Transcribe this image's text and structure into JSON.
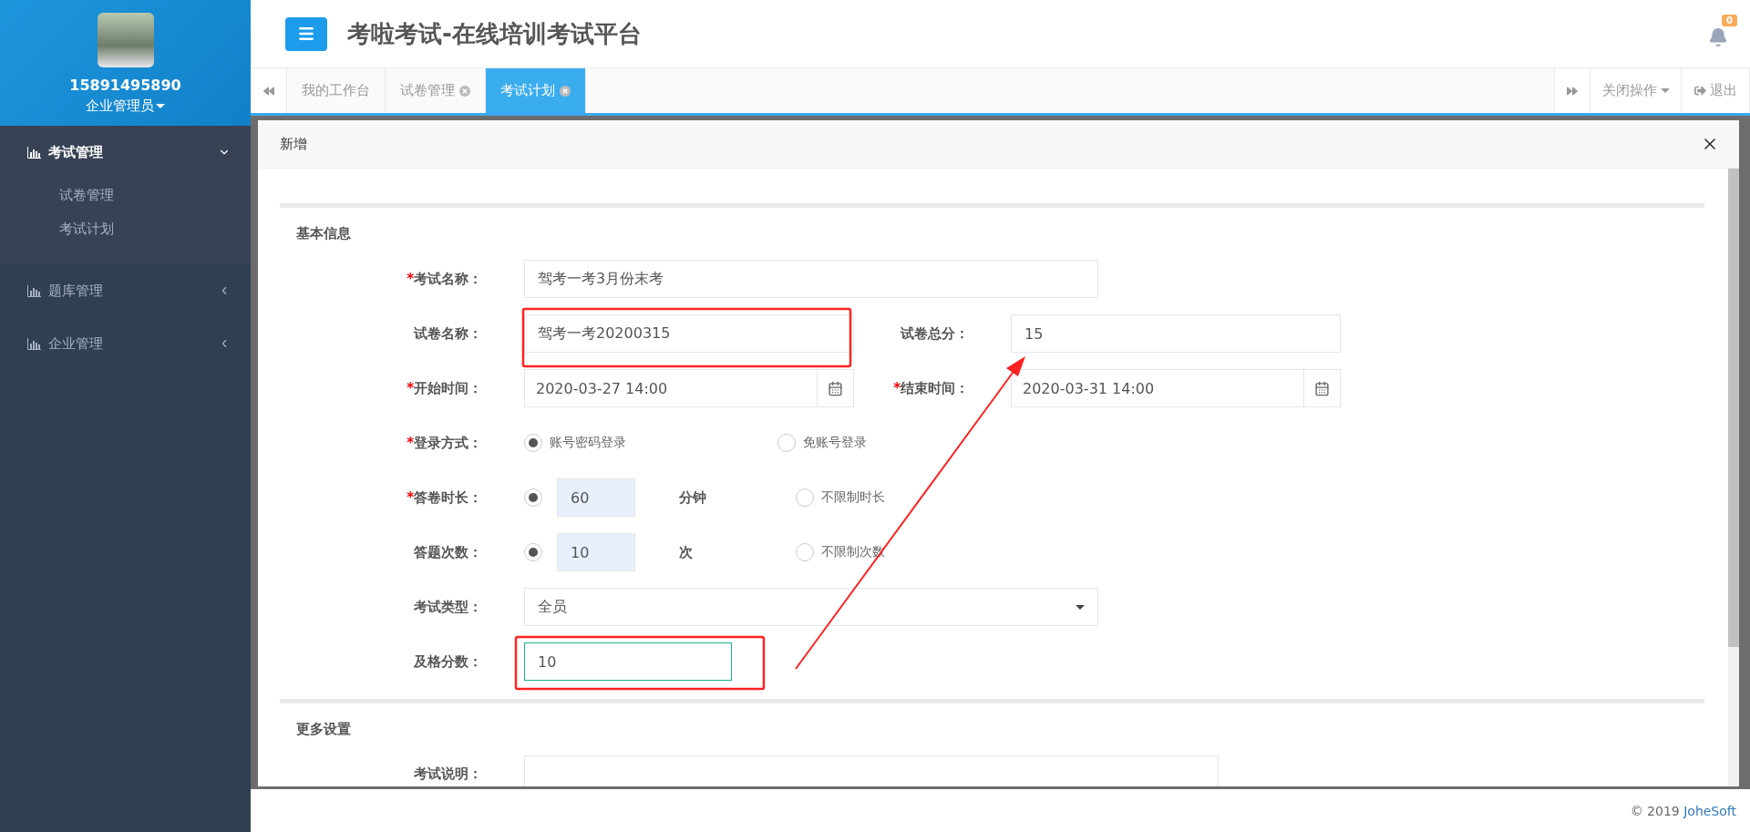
{
  "sidebar": {
    "user": {
      "phone": "15891495890",
      "role": "企业管理员"
    },
    "menu": [
      {
        "label": "考试管理",
        "expanded": true,
        "children": [
          {
            "label": "试卷管理"
          },
          {
            "label": "考试计划"
          }
        ]
      },
      {
        "label": "题库管理",
        "expanded": false
      },
      {
        "label": "企业管理",
        "expanded": false
      }
    ]
  },
  "header": {
    "title": "考啦考试-在线培训考试平台",
    "notification_count": "0"
  },
  "tabs": [
    {
      "label": "我的工作台",
      "closable": false,
      "selected": false
    },
    {
      "label": "试卷管理",
      "closable": true,
      "selected": false
    },
    {
      "label": "考试计划",
      "closable": true,
      "selected": true
    }
  ],
  "tab_actions": {
    "close_menu": "关闭操作",
    "logout": "退出"
  },
  "modal": {
    "title": "新增",
    "sections": [
      {
        "title": "基本信息",
        "rows": [
          {
            "fields": [
              {
                "kind": "text",
                "required_mark": "*",
                "label": "考试名称：",
                "value": "驾考一考3月份末考"
              }
            ]
          },
          {
            "fields": [
              {
                "kind": "text",
                "label": "试卷名称：",
                "value": "驾考一考20200315"
              },
              {
                "kind": "text",
                "label": "试卷总分：",
                "value": "15"
              }
            ]
          },
          {
            "fields": [
              {
                "kind": "date",
                "required_mark": "*",
                "label": "开始时间：",
                "value": "2020-03-27 14:00"
              },
              {
                "kind": "date",
                "required_mark": "*",
                "label": "结束时间：",
                "value": "2020-03-31 14:00"
              }
            ]
          },
          {
            "fields": [
              {
                "kind": "radio",
                "required_mark": "*",
                "label": "登录方式：",
                "options": [
                  {
                    "label": "账号密码登录",
                    "selected": true
                  },
                  {
                    "label": "免账号登录",
                    "selected": false
                  }
                ]
              }
            ]
          },
          {
            "fields": [
              {
                "kind": "radio",
                "required_mark": "*",
                "label": "答卷时长：",
                "options": [
                  {
                    "value": "60",
                    "unit": "分钟",
                    "selected": true
                  },
                  {
                    "label": "不限制时长",
                    "selected": false
                  }
                ]
              }
            ]
          },
          {
            "fields": [
              {
                "kind": "radio",
                "label": "答题次数：",
                "options": [
                  {
                    "value": "10",
                    "unit": "次",
                    "selected": true
                  },
                  {
                    "label": "不限制次数",
                    "selected": false
                  }
                ]
              }
            ]
          },
          {
            "fields": [
              {
                "kind": "select",
                "label": "考试类型：",
                "value": "全员"
              }
            ]
          },
          {
            "fields": [
              {
                "kind": "short_text",
                "focused": true,
                "label": "及格分数：",
                "value": "10"
              }
            ]
          }
        ]
      },
      {
        "title": "更多设置",
        "rows": [
          {
            "fields": [
              {
                "kind": "textarea",
                "label": "考试说明："
              }
            ]
          }
        ]
      }
    ]
  },
  "footer": {
    "text": "© 2019",
    "link": "JoheSoft"
  }
}
